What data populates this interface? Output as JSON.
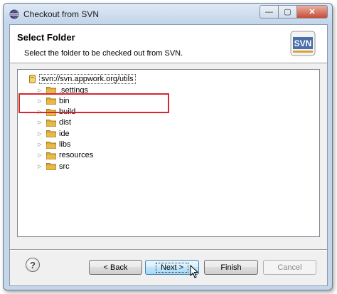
{
  "window": {
    "title": "Checkout from SVN",
    "caption": {
      "minimize": "—",
      "maximize": "▢",
      "close": "✕"
    }
  },
  "header": {
    "title": "Select Folder",
    "description": "Select the folder to be checked out from SVN.",
    "logo_text": "SVN"
  },
  "tree": {
    "root": {
      "label": "svn://svn.appwork.org/utils",
      "icon": "repository-icon",
      "selected": true
    },
    "children": [
      {
        "label": ".settings",
        "icon": "folder-icon"
      },
      {
        "label": "bin",
        "icon": "folder-icon"
      },
      {
        "label": "build",
        "icon": "folder-icon"
      },
      {
        "label": "dist",
        "icon": "folder-icon"
      },
      {
        "label": "ide",
        "icon": "folder-icon"
      },
      {
        "label": "libs",
        "icon": "folder-icon"
      },
      {
        "label": "resources",
        "icon": "folder-icon"
      },
      {
        "label": "src",
        "icon": "folder-icon"
      }
    ],
    "expander_glyph": "▷"
  },
  "footer": {
    "help": "?",
    "back_label": "< Back",
    "next_label": "Next >",
    "finish_label": "Finish",
    "cancel_label": "Cancel"
  },
  "colors": {
    "highlight": "#d9252c",
    "folder": "#e8b94a",
    "default_button_border": "#3c7fb1"
  }
}
